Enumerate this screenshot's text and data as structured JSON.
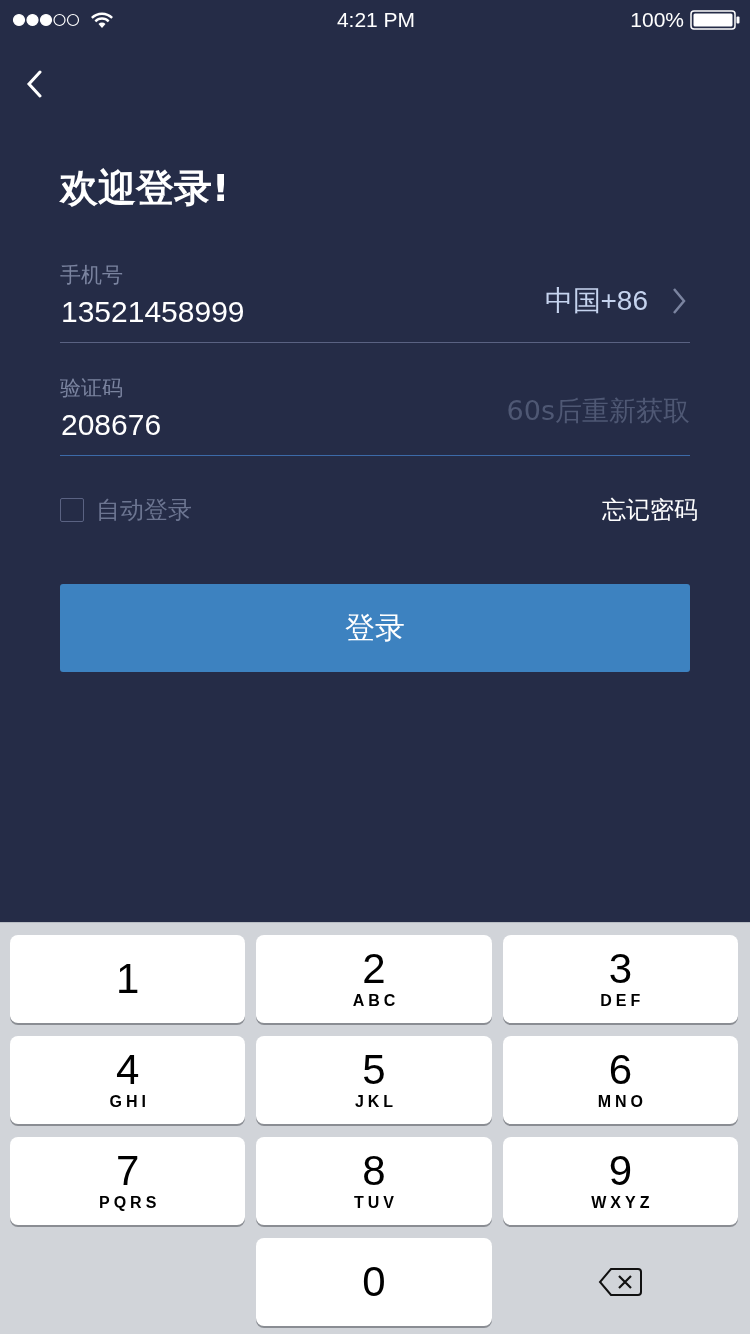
{
  "status_bar": {
    "time": "4:21 PM",
    "battery": "100%"
  },
  "title": "欢迎登录!",
  "phone": {
    "label": "手机号",
    "value": "13521458999",
    "country": "中国+86"
  },
  "code": {
    "label": "验证码",
    "value": "208676",
    "resend_hint": "60s后重新获取",
    "focused": true
  },
  "auto_login": {
    "label": "自动登录",
    "checked": false
  },
  "forgot_link": "忘记密码",
  "login_button": "登录",
  "keypad": [
    {
      "kind": "digit",
      "digit": "1"
    },
    {
      "kind": "digit",
      "digit": "2",
      "letters": "ABC"
    },
    {
      "kind": "digit",
      "digit": "3",
      "letters": "DEF"
    },
    {
      "kind": "digit",
      "digit": "4",
      "letters": "GHI"
    },
    {
      "kind": "digit",
      "digit": "5",
      "letters": "JKL"
    },
    {
      "kind": "digit",
      "digit": "6",
      "letters": "MNO"
    },
    {
      "kind": "digit",
      "digit": "7",
      "letters": "PQRS"
    },
    {
      "kind": "digit",
      "digit": "8",
      "letters": "TUV"
    },
    {
      "kind": "digit",
      "digit": "9",
      "letters": "WXYZ"
    },
    {
      "kind": "blank"
    },
    {
      "kind": "digit",
      "digit": "0"
    },
    {
      "kind": "delete"
    }
  ]
}
